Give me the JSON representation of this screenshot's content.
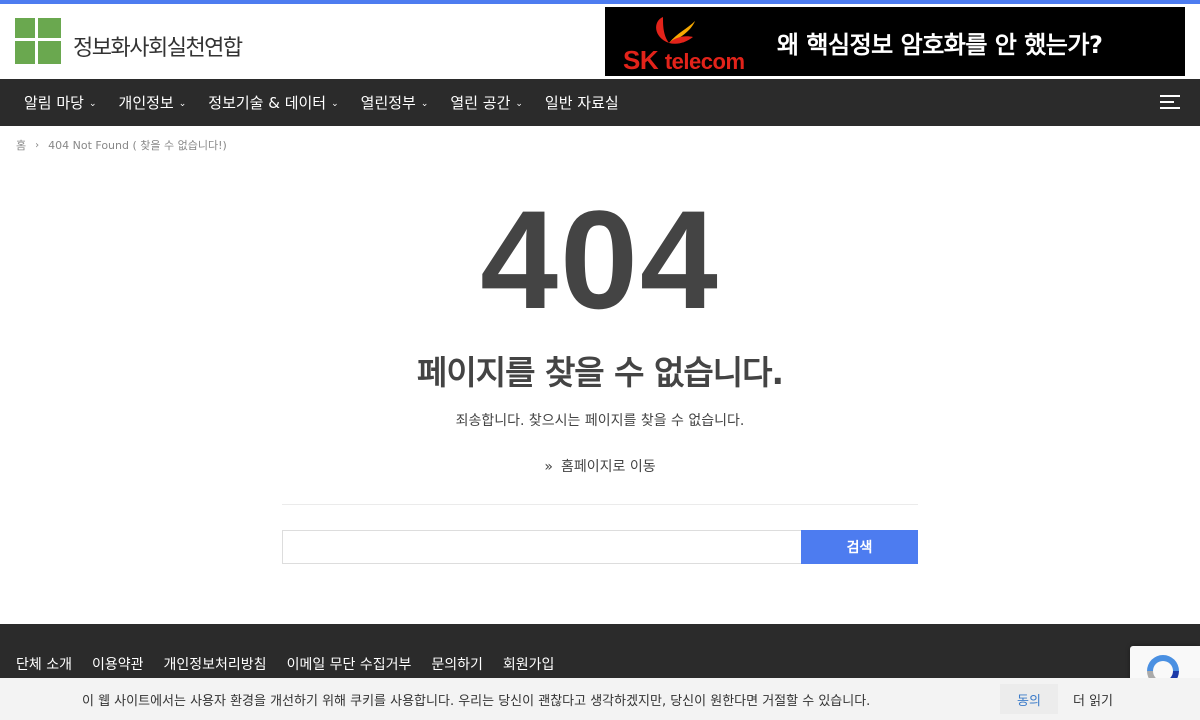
{
  "header": {
    "site_title": "정보화사회실천연합",
    "banner": {
      "brand_sk": "SK",
      "brand_telecom": "telecom",
      "headline": "왜 핵심정보 암호화를 안 했는가?"
    }
  },
  "nav": {
    "items": [
      {
        "label": "알림 마당",
        "has_dropdown": true
      },
      {
        "label": "개인정보",
        "has_dropdown": true
      },
      {
        "label": "정보기술 & 데이터",
        "has_dropdown": true
      },
      {
        "label": "열린정부",
        "has_dropdown": true
      },
      {
        "label": "열린 공간",
        "has_dropdown": true
      },
      {
        "label": "일반 자료실",
        "has_dropdown": false
      }
    ],
    "menu_icon": "hamburger-icon"
  },
  "breadcrumb": {
    "home": "홈",
    "current": "404 Not Found ( 찾을 수 없습니다!)"
  },
  "main": {
    "code": "404",
    "title": "페이지를 찾을 수 없습니다.",
    "description": "죄송합니다. 찾으시는 페이지를 찾을 수 없습니다.",
    "home_link": "홈페이지로 이동",
    "search": {
      "value": "",
      "button_label": "검색"
    }
  },
  "footer": {
    "links": [
      "단체 소개",
      "이용약관",
      "개인정보처리방침",
      "이메일 무단 수집거부",
      "문의하기",
      "회원가입"
    ]
  },
  "cookie": {
    "text": "이 웹 사이트에서는 사용자 환경을 개선하기 위해 쿠키를 사용합니다. 우리는 당신이 괜찮다고 생각하겠지만, 당신이 원한다면 거절할 수 있습니다.",
    "accept_label": "동의",
    "more_label": "더 읽기"
  },
  "colors": {
    "accent": "#4d7cf0",
    "nav_bg": "#2b2b2b",
    "logo_green": "#6aa84f",
    "sk_red": "#e2231a",
    "sk_orange": "#f6a800"
  }
}
